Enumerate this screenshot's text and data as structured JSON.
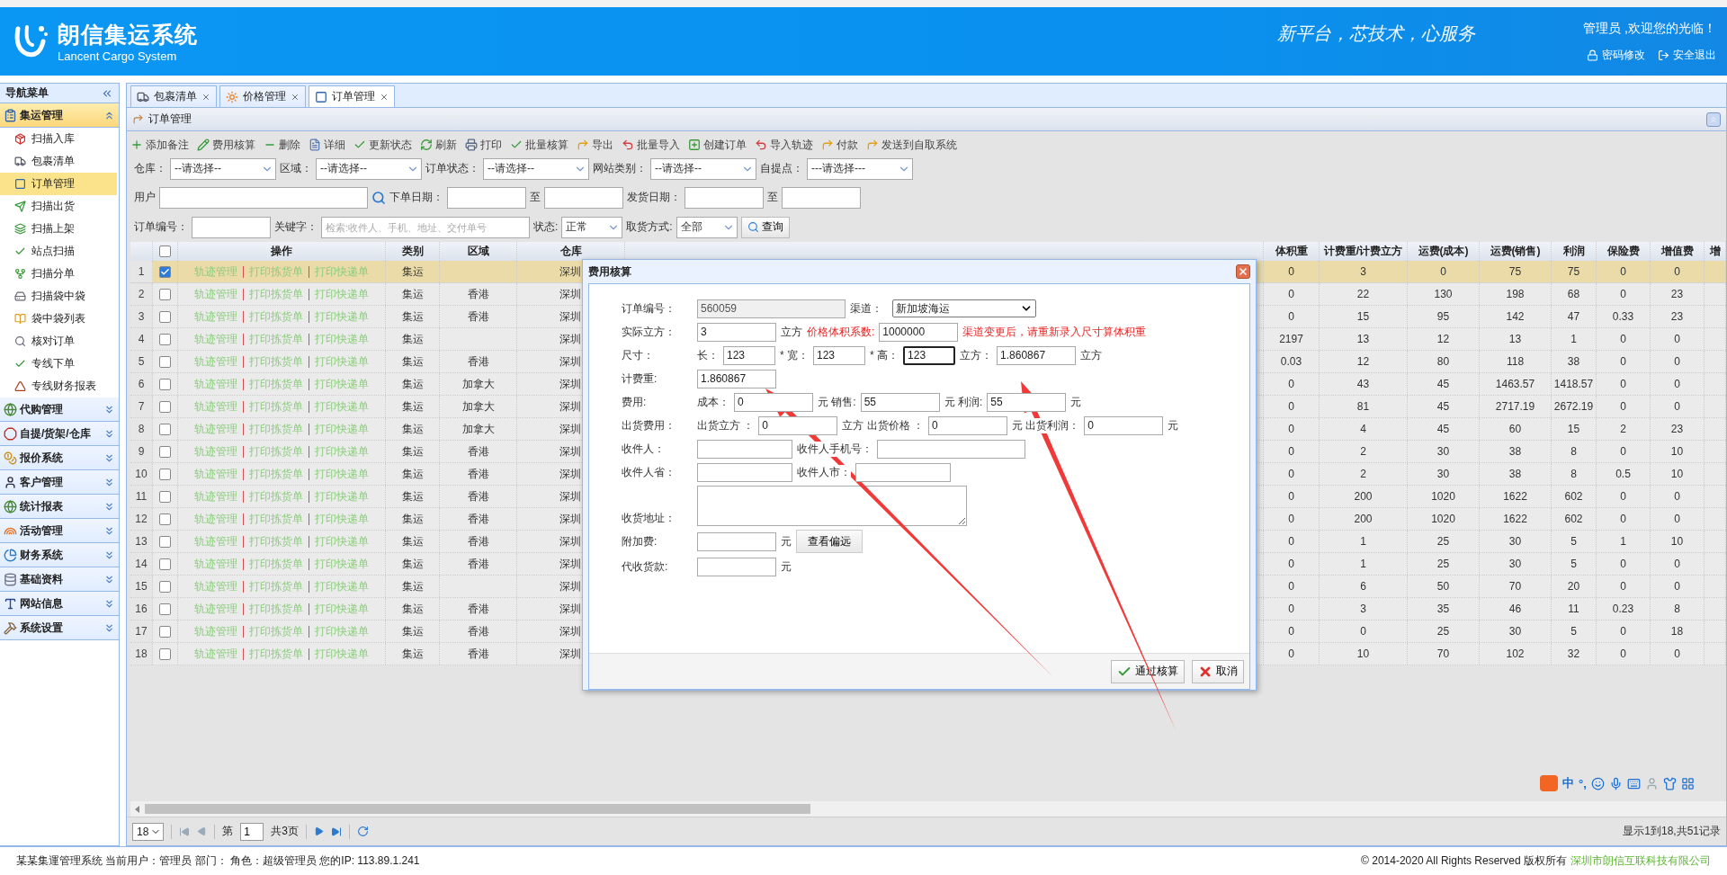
{
  "header": {
    "title": "朗信集运系统",
    "subtitle": "Lancent Cargo System",
    "slogan": "新平台，芯技术，心服务",
    "welcome": "管理员 ,欢迎您的光临！",
    "links": [
      "密码修改",
      "安全退出"
    ]
  },
  "sidebar": {
    "title": "导航菜单",
    "groups": [
      {
        "label": "集运管理",
        "expanded": true,
        "items": [
          {
            "label": "扫描入库",
            "selected": false
          },
          {
            "label": "包裹清单",
            "selected": false
          },
          {
            "label": "订单管理",
            "selected": true
          },
          {
            "label": "扫描出货",
            "selected": false
          },
          {
            "label": "扫描上架",
            "selected": false
          },
          {
            "label": "站点扫描",
            "selected": false
          },
          {
            "label": "扫描分单",
            "selected": false
          },
          {
            "label": "扫描袋中袋",
            "selected": false
          },
          {
            "label": "袋中袋列表",
            "selected": false
          },
          {
            "label": "核对订单",
            "selected": false
          },
          {
            "label": "专线下单",
            "selected": false
          },
          {
            "label": "专线财务报表",
            "selected": false
          }
        ]
      },
      {
        "label": "代购管理",
        "expanded": false
      },
      {
        "label": "自提/货架/仓库",
        "expanded": false
      },
      {
        "label": "报价系统",
        "expanded": false
      },
      {
        "label": "客户管理",
        "expanded": false
      },
      {
        "label": "统计报表",
        "expanded": false
      },
      {
        "label": "活动管理",
        "expanded": false
      },
      {
        "label": "财务系统",
        "expanded": false
      },
      {
        "label": "基础资料",
        "expanded": false
      },
      {
        "label": "网站信息",
        "expanded": false
      },
      {
        "label": "系统设置",
        "expanded": false
      }
    ]
  },
  "tabs": [
    {
      "label": "包裹清单",
      "selected": false
    },
    {
      "label": "价格管理",
      "selected": false
    },
    {
      "label": "订单管理",
      "selected": true
    }
  ],
  "panel": {
    "title": "订单管理"
  },
  "toolbar": [
    "添加备注",
    "费用核算",
    "删除",
    "详细",
    "更新状态",
    "刷新",
    "打印",
    "批量核算",
    "导出",
    "批量导入",
    "创建订单",
    "导入轨迹",
    "付款",
    "发送到自取系统"
  ],
  "filters": [
    [
      {
        "kind": "label",
        "text": "仓库："
      },
      {
        "kind": "select",
        "value": "--请选择--"
      },
      {
        "kind": "label",
        "text": "区域："
      },
      {
        "kind": "select",
        "value": "--请选择--"
      },
      {
        "kind": "label",
        "text": "订单状态："
      },
      {
        "kind": "select",
        "value": "--请选择--"
      },
      {
        "kind": "label",
        "text": "网站类别："
      },
      {
        "kind": "select",
        "value": "--请选择--"
      },
      {
        "kind": "label",
        "text": "自提点："
      },
      {
        "kind": "select",
        "value": "---请选择---"
      }
    ],
    [
      {
        "kind": "label",
        "text": "用户"
      },
      {
        "kind": "wide_input"
      },
      {
        "kind": "search"
      },
      {
        "kind": "label",
        "text": "下单日期："
      },
      {
        "kind": "input"
      },
      {
        "kind": "label",
        "text": "至"
      },
      {
        "kind": "input"
      },
      {
        "kind": "label",
        "text": "发货日期："
      },
      {
        "kind": "input"
      },
      {
        "kind": "label",
        "text": "至"
      },
      {
        "kind": "input"
      }
    ],
    [
      {
        "kind": "label",
        "text": "订单编号："
      },
      {
        "kind": "input"
      },
      {
        "kind": "label",
        "text": "关键字："
      },
      {
        "kind": "wide_input",
        "placeholder": "检索:收件人、手机、地址、交付单号"
      },
      {
        "kind": "label",
        "text": "状态:"
      },
      {
        "kind": "small_select",
        "value": "正常"
      },
      {
        "kind": "label",
        "text": "取货方式:"
      },
      {
        "kind": "small_select",
        "value": "全部"
      },
      {
        "kind": "button",
        "text": "查询"
      }
    ]
  ],
  "table": {
    "select_all_checked": false,
    "left_columns": [
      "操作",
      "类别",
      "区域",
      "仓库"
    ],
    "right_columns": [
      "体积重",
      "计费重/计费立方",
      "运费(成本)",
      "运费(销售)",
      "利润",
      "保险费",
      "增值费",
      "增"
    ],
    "rows": [
      {
        "no": "1",
        "checked": true,
        "selected": true,
        "actions": [
          "轨迹管理",
          "打印拣货单",
          "打印快递单"
        ],
        "type": "集运",
        "warehouse": "深圳",
        "values": [
          "0",
          "3",
          "0",
          "75",
          "75",
          "0",
          "0"
        ]
      },
      {
        "no": "2",
        "checked": false,
        "selected": false,
        "actions": [
          "轨迹管理",
          "打印拣货单",
          "打印快递单"
        ],
        "type": "集运",
        "region": "香港",
        "warehouse": "深圳",
        "values": [
          "0",
          "22",
          "130",
          "198",
          "68",
          "0",
          "23"
        ]
      },
      {
        "no": "3",
        "checked": false,
        "selected": false,
        "actions": [
          "轨迹管理",
          "打印拣货单",
          "打印快递单"
        ],
        "type": "集运",
        "region": "香港",
        "warehouse": "深圳",
        "values": [
          "0",
          "15",
          "95",
          "142",
          "47",
          "0.33",
          "23"
        ]
      },
      {
        "no": "4",
        "checked": false,
        "selected": false,
        "actions": [
          "轨迹管理",
          "打印拣货单",
          "打印快递单"
        ],
        "type": "集运",
        "warehouse": "深圳",
        "values": [
          "2197",
          "13",
          "12",
          "13",
          "1",
          "0",
          "0"
        ]
      },
      {
        "no": "5",
        "checked": false,
        "selected": false,
        "actions": [
          "轨迹管理",
          "打印拣货单",
          "打印快递单"
        ],
        "type": "集运",
        "region": "香港",
        "warehouse": "深圳",
        "values": [
          "0.03",
          "12",
          "80",
          "118",
          "38",
          "0",
          "0"
        ]
      },
      {
        "no": "6",
        "checked": false,
        "selected": false,
        "actions": [
          "轨迹管理",
          "打印拣货单",
          "打印快递单"
        ],
        "type": "集运",
        "region": "加拿大",
        "warehouse": "深圳",
        "values": [
          "0",
          "43",
          "45",
          "1463.57",
          "1418.57",
          "0",
          "0"
        ]
      },
      {
        "no": "7",
        "checked": false,
        "selected": false,
        "actions": [
          "轨迹管理",
          "打印拣货单",
          "打印快递单"
        ],
        "type": "集运",
        "region": "加拿大",
        "warehouse": "深圳",
        "values": [
          "0",
          "81",
          "45",
          "2717.19",
          "2672.19",
          "0",
          "0"
        ]
      },
      {
        "no": "8",
        "checked": false,
        "selected": false,
        "actions": [
          "轨迹管理",
          "打印拣货单",
          "打印快递单"
        ],
        "type": "集运",
        "region": "加拿大",
        "warehouse": "深圳",
        "values": [
          "0",
          "4",
          "45",
          "60",
          "15",
          "2",
          "23"
        ]
      },
      {
        "no": "9",
        "checked": false,
        "selected": false,
        "actions": [
          "轨迹管理",
          "打印拣货单",
          "打印快递单"
        ],
        "type": "集运",
        "region": "香港",
        "warehouse": "深圳",
        "values": [
          "0",
          "2",
          "30",
          "38",
          "8",
          "0",
          "10"
        ]
      },
      {
        "no": "10",
        "checked": false,
        "selected": false,
        "actions": [
          "轨迹管理",
          "打印拣货单",
          "打印快递单"
        ],
        "type": "集运",
        "region": "香港",
        "warehouse": "深圳",
        "values": [
          "0",
          "2",
          "30",
          "38",
          "8",
          "0.5",
          "10"
        ]
      },
      {
        "no": "11",
        "checked": false,
        "selected": false,
        "actions": [
          "轨迹管理",
          "打印拣货单",
          "打印快递单"
        ],
        "type": "集运",
        "region": "香港",
        "warehouse": "深圳",
        "values": [
          "0",
          "200",
          "1020",
          "1622",
          "602",
          "0",
          "0"
        ]
      },
      {
        "no": "12",
        "checked": false,
        "selected": false,
        "actions": [
          "轨迹管理",
          "打印拣货单",
          "打印快递单"
        ],
        "type": "集运",
        "region": "香港",
        "warehouse": "深圳",
        "values": [
          "0",
          "200",
          "1020",
          "1622",
          "602",
          "0",
          "0"
        ]
      },
      {
        "no": "13",
        "checked": false,
        "selected": false,
        "actions": [
          "轨迹管理",
          "打印拣货单",
          "打印快递单"
        ],
        "type": "集运",
        "region": "香港",
        "warehouse": "深圳",
        "values": [
          "0",
          "1",
          "25",
          "30",
          "5",
          "1",
          "10"
        ]
      },
      {
        "no": "14",
        "checked": false,
        "selected": false,
        "actions": [
          "轨迹管理",
          "打印拣货单",
          "打印快递单"
        ],
        "type": "集运",
        "region": "香港",
        "warehouse": "深圳",
        "values": [
          "0",
          "1",
          "25",
          "30",
          "5",
          "0",
          "0"
        ]
      },
      {
        "no": "15",
        "checked": false,
        "selected": false,
        "actions": [
          "轨迹管理",
          "打印拣货单",
          "打印快递单"
        ],
        "type": "集运",
        "warehouse": "深圳",
        "values": [
          "0",
          "6",
          "50",
          "70",
          "20",
          "0",
          "0"
        ]
      },
      {
        "no": "16",
        "checked": false,
        "selected": false,
        "actions": [
          "轨迹管理",
          "打印拣货单",
          "打印快递单"
        ],
        "type": "集运",
        "region": "香港",
        "warehouse": "深圳",
        "values": [
          "0",
          "3",
          "35",
          "46",
          "11",
          "0.23",
          "8"
        ]
      },
      {
        "no": "17",
        "checked": false,
        "selected": false,
        "actions": [
          "轨迹管理",
          "打印拣货单",
          "打印快递单"
        ],
        "type": "集运",
        "region": "香港",
        "warehouse": "深圳",
        "values": [
          "0",
          "0",
          "25",
          "30",
          "5",
          "0",
          "18"
        ]
      },
      {
        "no": "18",
        "checked": false,
        "selected": false,
        "actions": [
          "轨迹管理",
          "打印拣货单",
          "打印快递单"
        ],
        "type": "集运",
        "region": "香港",
        "warehouse": "深圳",
        "values": [
          "0",
          "10",
          "70",
          "102",
          "32",
          "0",
          "0"
        ]
      }
    ]
  },
  "pagination": {
    "page_size": "18",
    "page_prefix": "第",
    "page": "1",
    "page_total": "共3页",
    "summary": "显示1到18,共51记录"
  },
  "ime_bar": [
    "中",
    "°,"
  ],
  "dialog": {
    "title": "费用核算",
    "rows": [
      {
        "label": "订单编号：",
        "items": [
          {
            "kind": "wide_input",
            "value": "560059",
            "disabled": true
          },
          {
            "kind": "text",
            "text": "渠道："
          },
          {
            "kind": "select",
            "value": "新加坡海运"
          }
        ]
      },
      {
        "label": "实际立方：",
        "items": [
          {
            "kind": "input",
            "value": "3"
          },
          {
            "kind": "text",
            "text": "立方"
          },
          {
            "kind": "note",
            "text": "价格体积系数:"
          },
          {
            "kind": "input",
            "value": "1000000"
          },
          {
            "kind": "note",
            "text": "渠道变更后，请重新录入尺寸算体积重"
          }
        ]
      },
      {
        "label": "尺寸：",
        "items": [
          {
            "kind": "text",
            "text": "长："
          },
          {
            "kind": "short_input",
            "value": "123"
          },
          {
            "kind": "text",
            "text": "* 宽："
          },
          {
            "kind": "short_input",
            "value": "123"
          },
          {
            "kind": "text",
            "text": "* 高："
          },
          {
            "kind": "short_input",
            "value": "123",
            "focused": true
          },
          {
            "kind": "text",
            "text": "立方："
          },
          {
            "kind": "input",
            "value": "1.860867"
          },
          {
            "kind": "text",
            "text": "立方"
          }
        ]
      },
      {
        "label": "计费重:",
        "items": [
          {
            "kind": "input",
            "value": "1.860867"
          }
        ]
      },
      {
        "label": "费用:",
        "items": [
          {
            "kind": "text",
            "text": "成本："
          },
          {
            "kind": "input",
            "value": "0"
          },
          {
            "kind": "text",
            "text": "元 销售:"
          },
          {
            "kind": "input",
            "value": "55"
          },
          {
            "kind": "text",
            "text": "元 利润:"
          },
          {
            "kind": "input",
            "value": "55"
          },
          {
            "kind": "text",
            "text": "元"
          }
        ]
      },
      {
        "label": "出货费用：",
        "items": [
          {
            "kind": "text",
            "text": "出货立方 ："
          },
          {
            "kind": "input",
            "value": "0"
          },
          {
            "kind": "text",
            "text": "立方 出货价格 ："
          },
          {
            "kind": "input",
            "value": "0"
          },
          {
            "kind": "text",
            "text": "元 出货利润："
          },
          {
            "kind": "input",
            "value": "0"
          },
          {
            "kind": "text",
            "text": "元"
          }
        ]
      },
      {
        "label": "收件人：",
        "items": [
          {
            "kind": "mid_input"
          },
          {
            "kind": "text",
            "text": "收件人手机号："
          },
          {
            "kind": "wide_input"
          }
        ]
      },
      {
        "label": "收件人省：",
        "items": [
          {
            "kind": "mid_input"
          },
          {
            "kind": "text",
            "text": "收件人市："
          },
          {
            "kind": "mid_input"
          }
        ]
      },
      {
        "label": "收货地址：",
        "items": [
          {
            "kind": "textarea"
          }
        ]
      },
      {
        "label": "附加费:",
        "items": [
          {
            "kind": "input"
          },
          {
            "kind": "text",
            "text": "元"
          },
          {
            "kind": "button",
            "text": "查看偏远"
          }
        ]
      },
      {
        "label": "代收货款:",
        "items": [
          {
            "kind": "input"
          },
          {
            "kind": "text",
            "text": "元"
          }
        ]
      }
    ],
    "buttons": [
      {
        "kind": "ok",
        "label": "通过核算"
      },
      {
        "kind": "cancel",
        "label": "取消"
      }
    ]
  },
  "footer": {
    "info": "某某集運管理系统 当前用户：管理员 部门： 角色：超级管理员 您的IP: 113.89.1.241",
    "copyright": "© 2014-2020 All Rights Reserved 版权所有",
    "company": "深圳市朗信互联科技有限公司"
  }
}
